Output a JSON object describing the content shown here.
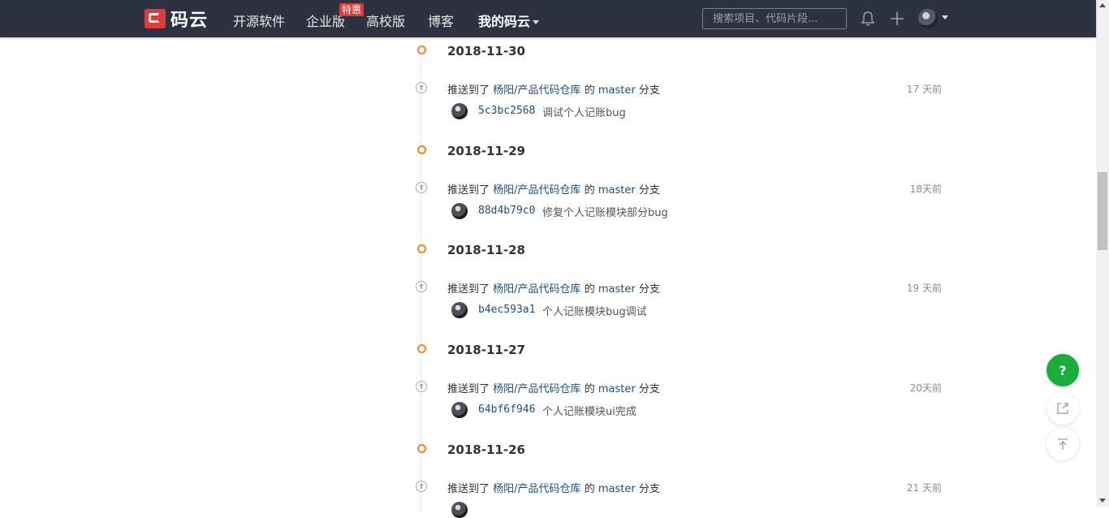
{
  "nav": {
    "logo_text": "码云",
    "items": [
      "开源软件",
      "企业版",
      "高校版",
      "博客",
      "我的码云"
    ],
    "promo_badge": "特惠",
    "search_placeholder": "搜索项目、代码片段..."
  },
  "activity": {
    "push_prefix": "推送到了",
    "repo": "杨阳/产品代码仓库",
    "of": "的",
    "branch": "master",
    "branch_suffix": "分支",
    "days": [
      {
        "date": "2018-11-30",
        "time_ago": "17 天前",
        "hash": "5c3bc2568",
        "message": "调试个人记账bug"
      },
      {
        "date": "2018-11-29",
        "time_ago": "18天前",
        "hash": "88d4b79c0",
        "message": "修复个人记账模块部分bug"
      },
      {
        "date": "2018-11-28",
        "time_ago": "19 天前",
        "hash": "b4ec593a1",
        "message": "个人记账模块bug调试"
      },
      {
        "date": "2018-11-27",
        "time_ago": "20天前",
        "hash": "64bf6f946",
        "message": "个人记账模块ui完成"
      },
      {
        "date": "2018-11-26",
        "time_ago": "21 天前"
      }
    ]
  },
  "help_button": "?",
  "colors": {
    "nav_bg": "#2e3240",
    "accent_orange": "#f0852c",
    "link": "#1f4f7a",
    "help_green": "#1aad3c",
    "badge_red": "#e53935"
  }
}
